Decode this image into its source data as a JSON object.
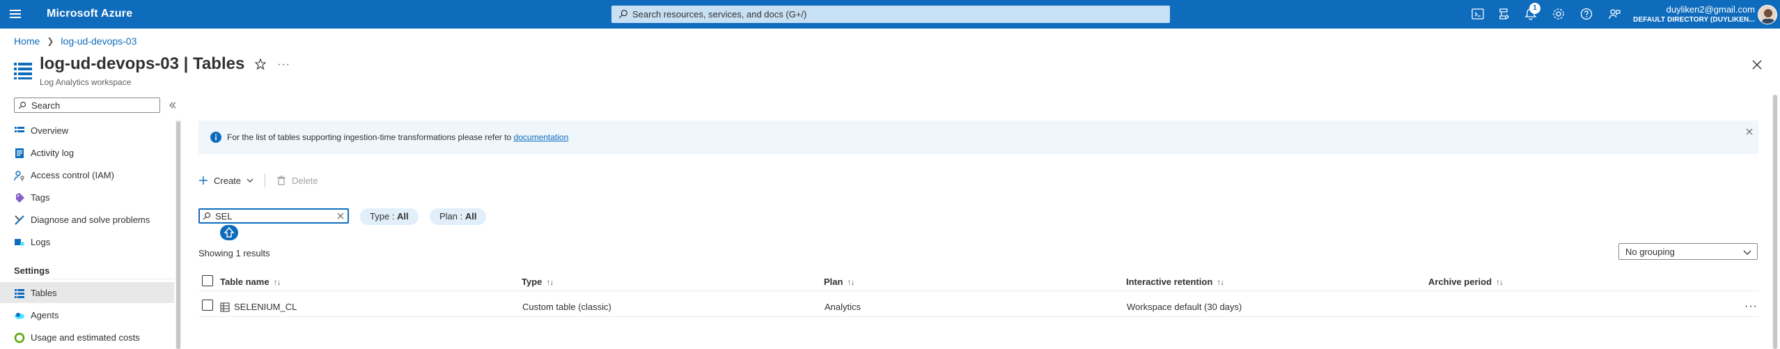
{
  "topbar": {
    "brand": "Microsoft Azure",
    "search_placeholder": "Search resources, services, and docs (G+/)",
    "notification_count": "1",
    "account_email": "duyliken2@gmail.com",
    "account_directory": "DEFAULT DIRECTORY (DUYLIKEN...",
    "icons": [
      "cloud-shell-icon",
      "directory-filter-icon",
      "notifications-icon",
      "settings-icon",
      "help-icon",
      "feedback-icon"
    ]
  },
  "breadcrumb": {
    "home": "Home",
    "resource": "log-ud-devops-03"
  },
  "header": {
    "title": "log-ud-devops-03 | Tables",
    "subtitle": "Log Analytics workspace",
    "more": "···"
  },
  "sidebar": {
    "search_placeholder": "Search",
    "items": [
      {
        "label": "Overview",
        "icon": "overview-icon"
      },
      {
        "label": "Activity log",
        "icon": "activity-log-icon"
      },
      {
        "label": "Access control (IAM)",
        "icon": "iam-icon"
      },
      {
        "label": "Tags",
        "icon": "tag-icon"
      },
      {
        "label": "Diagnose and solve problems",
        "icon": "wrench-icon"
      },
      {
        "label": "Logs",
        "icon": "logs-icon"
      }
    ],
    "section_settings": "Settings",
    "settings_items": [
      {
        "label": "Tables",
        "icon": "table-icon",
        "active": true
      },
      {
        "label": "Agents",
        "icon": "agents-icon"
      },
      {
        "label": "Usage and estimated costs",
        "icon": "usage-icon"
      }
    ]
  },
  "banner": {
    "text": "For the list of tables supporting ingestion-time transformations please refer to ",
    "link": "documentation"
  },
  "toolbar": {
    "create": "Create",
    "delete": "Delete"
  },
  "filters": {
    "search_value": "SEL",
    "type_label": "Type : ",
    "type_value": "All",
    "plan_label": "Plan : ",
    "plan_value": "All"
  },
  "results_text": "Showing 1 results",
  "grouping_value": "No grouping",
  "table": {
    "columns": [
      "Table name",
      "Type",
      "Plan",
      "Interactive retention",
      "Archive period"
    ],
    "rows": [
      {
        "name": "SELENIUM_CL",
        "type": "Custom table (classic)",
        "plan": "Analytics",
        "retention": "Workspace default (30 days)",
        "archive": "",
        "more": "···"
      }
    ]
  },
  "colors": {
    "brand_blue": "#0f6cbd",
    "banner_bg": "#eff6fc",
    "pill_bg": "#e1effa"
  }
}
